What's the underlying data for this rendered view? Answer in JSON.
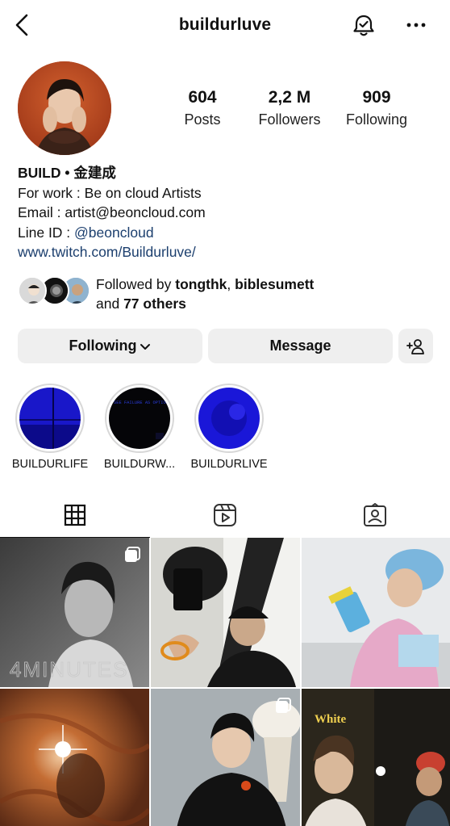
{
  "header": {
    "username": "buildurluve",
    "icons": [
      "chevron-left-icon",
      "bell-check-icon",
      "more-horizontal-icon"
    ]
  },
  "stats": {
    "posts": {
      "value": "604",
      "label": "Posts"
    },
    "followers": {
      "value": "2,2 M",
      "label": "Followers"
    },
    "following": {
      "value": "909",
      "label": "Following"
    }
  },
  "bio": {
    "name": "BUILD • 金建成",
    "line1": "For work : Be on cloud Artists",
    "line2": "Email : artist@beoncloud.com",
    "line3_prefix": "Line ID : ",
    "line3_tag": "@beoncloud",
    "link": "www.twitch.com/Buildurluve/"
  },
  "followed_by": {
    "prefix": "Followed by ",
    "user1": "tongthk",
    "separator": ", ",
    "user2": "biblesumett",
    "and": "and ",
    "others": "77 others"
  },
  "actions": {
    "following": "Following",
    "message": "Message"
  },
  "highlights": [
    {
      "label": "BUILDURLIFE"
    },
    {
      "label": "BUILDURW..."
    },
    {
      "label": "BUILDURLIVE"
    }
  ],
  "highlight_texts": {
    "h2_overlay": "SEE FAILURE AS OPTION"
  },
  "tabs": [
    "grid-icon",
    "reels-icon",
    "tagged-icon"
  ],
  "posts": {
    "p1_text": "4MINUTES",
    "p6_text": "White"
  },
  "colors": {
    "link": "#1c3f6e",
    "button_bg": "#efefef",
    "highlight_blue": "#1a17d8"
  }
}
